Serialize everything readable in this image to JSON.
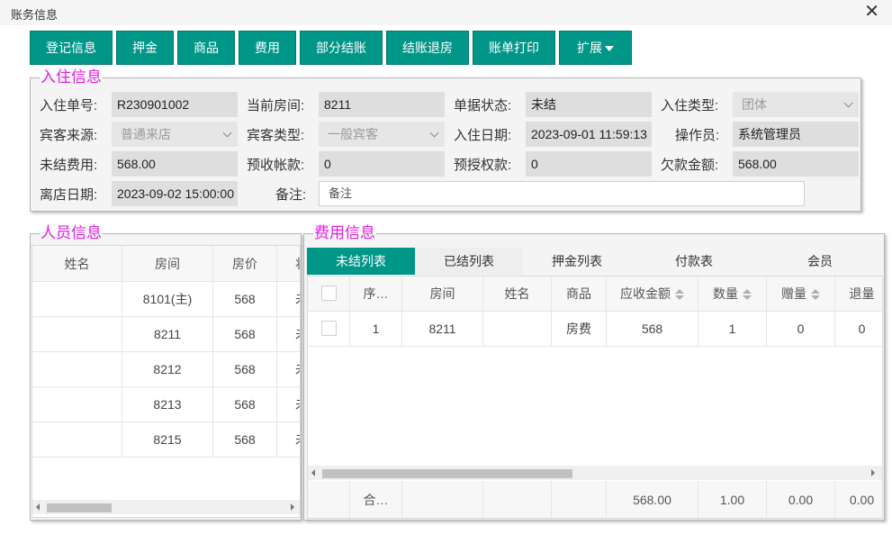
{
  "window": {
    "title": "账务信息",
    "close": "✕"
  },
  "toolbar": [
    "登记信息",
    "押金",
    "商品",
    "费用",
    "部分结账",
    "结账退房",
    "账单打印",
    "扩展"
  ],
  "checkin": {
    "legend": "入住信息",
    "order_no_label": "入住单号:",
    "order_no": "R230901002",
    "room_label": "当前房间:",
    "room": "8211",
    "doc_status_label": "单据状态:",
    "doc_status": "未结",
    "checkin_type_label": "入住类型:",
    "checkin_type": "团体",
    "source_label": "宾客来源:",
    "source": "普通来店",
    "guest_type_label": "宾客类型:",
    "guest_type": "一般宾客",
    "checkin_date_label": "入住日期:",
    "checkin_date": "2023-09-01 11:59:13",
    "operator_label": "操作员:",
    "operator": "系统管理员",
    "unsettled_label": "未结费用:",
    "unsettled": "568.00",
    "prepaid_label": "预收帐款:",
    "prepaid": "0",
    "preauth_label": "预授权款:",
    "preauth": "0",
    "owed_label": "欠款金额:",
    "owed": "568.00",
    "depart_label": "离店日期:",
    "depart": "2023-09-02 15:00:00",
    "note_label": "备注:",
    "note_placeholder": "备注"
  },
  "persons": {
    "legend": "人员信息",
    "headers": [
      "姓名",
      "房间",
      "房价",
      "状"
    ],
    "rows": [
      [
        "",
        "8101(主)",
        "568",
        "未"
      ],
      [
        "",
        "8211",
        "568",
        "未"
      ],
      [
        "",
        "8212",
        "568",
        "未"
      ],
      [
        "",
        "8213",
        "568",
        "未"
      ],
      [
        "",
        "8215",
        "568",
        "未"
      ]
    ]
  },
  "fees": {
    "legend": "费用信息",
    "tabs": [
      "未结列表",
      "已结列表",
      "押金列表",
      "付款表",
      "会员"
    ],
    "headers": [
      "",
      "序…",
      "房间",
      "姓名",
      "商品",
      "应收金额",
      "数量",
      "赠量",
      "退量"
    ],
    "rows": [
      [
        "",
        "1",
        "8211",
        "",
        "房费",
        "568",
        "1",
        "0",
        "0"
      ]
    ],
    "footer": [
      "",
      "合…",
      "",
      "",
      "",
      "568.00",
      "1.00",
      "0.00",
      "0.00"
    ]
  },
  "colors": {
    "accent": "#009688",
    "legend": "#e020e0"
  }
}
